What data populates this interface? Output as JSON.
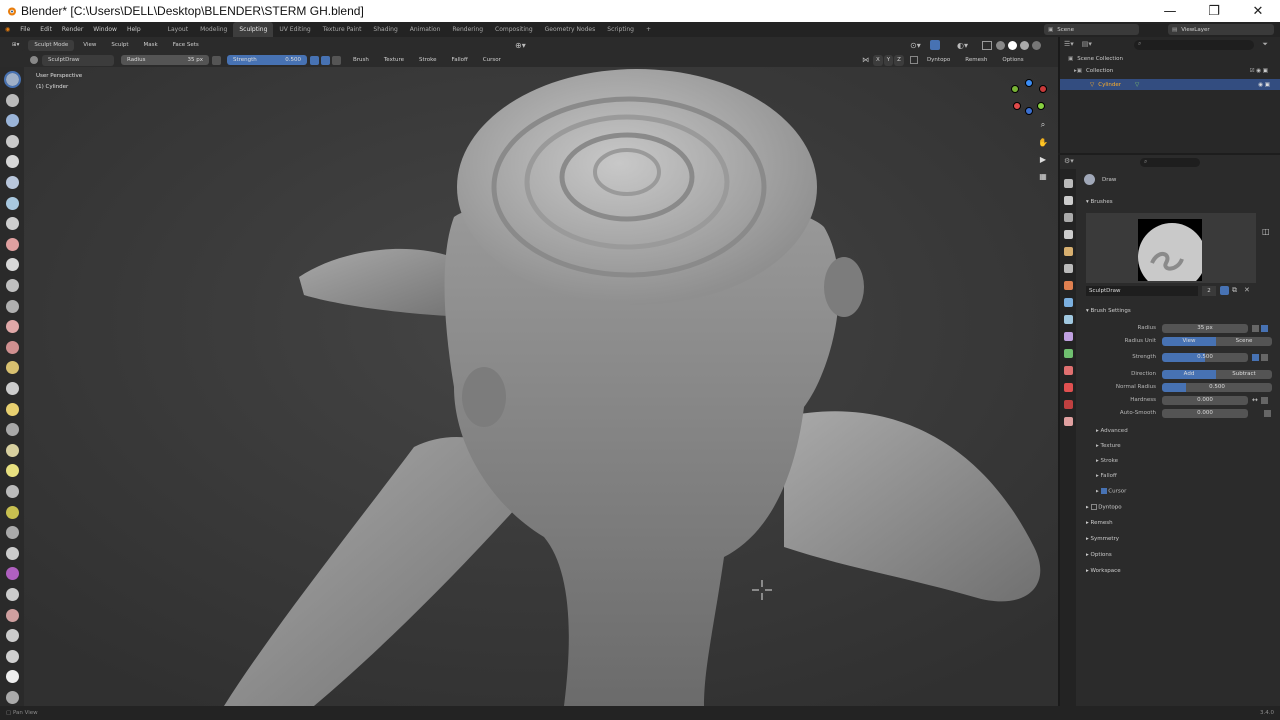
{
  "window": {
    "title": "Blender* [C:\\Users\\DELL\\Desktop\\BLENDER\\STERM GH.blend]",
    "minimize": "—",
    "maximize": "❐",
    "close": "✕"
  },
  "menu": {
    "items": [
      "File",
      "Edit",
      "Render",
      "Window",
      "Help"
    ],
    "workspaces": [
      "Layout",
      "Modeling",
      "Sculpting",
      "UV Editing",
      "Texture Paint",
      "Shading",
      "Animation",
      "Rendering",
      "Compositing",
      "Geometry Nodes",
      "Scripting"
    ],
    "active_workspace": "Sculpting",
    "add_tab": "+",
    "scene": "Scene",
    "view_layer": "ViewLayer"
  },
  "header": {
    "mode": "Sculpt Mode",
    "menus": [
      "View",
      "Sculpt",
      "Mask",
      "Face Sets"
    ]
  },
  "tool_header": {
    "brush_name": "SculptDraw",
    "radius_label": "Radius",
    "radius_value": "35 px",
    "strength_label": "Strength",
    "strength_value": "0.500",
    "menus": [
      "Brush",
      "Texture",
      "Stroke",
      "Falloff",
      "Cursor"
    ],
    "axes": [
      "X",
      "Y",
      "Z"
    ],
    "dyntopo": "Dyntopo",
    "remesh": "Remesh",
    "options": "Options"
  },
  "viewport": {
    "perspective": "User Perspective",
    "object": "(1) Cylinder"
  },
  "outliner": {
    "items": [
      "Scene Collection",
      "Collection",
      "Cylinder"
    ]
  },
  "properties": {
    "brush_title": "Draw",
    "brushes_section": "Brushes",
    "brush_field": "SculptDraw",
    "brush_users": "2",
    "brush_settings": "Brush Settings",
    "radius_label": "Radius",
    "radius_value": "35 px",
    "radius_unit_label": "Radius Unit",
    "radius_unit_view": "View",
    "radius_unit_scene": "Scene",
    "strength_label": "Strength",
    "strength_value": "0.500",
    "direction_label": "Direction",
    "direction_add": "Add",
    "direction_subtract": "Subtract",
    "normal_radius_label": "Normal Radius",
    "normal_radius_value": "0.500",
    "hardness_label": "Hardness",
    "hardness_value": "0.000",
    "auto_smooth_label": "Auto-Smooth",
    "auto_smooth_value": "0.000",
    "subpanels": [
      "Advanced",
      "Texture",
      "Stroke",
      "Falloff",
      "Cursor"
    ],
    "panels": [
      "Dyntopo",
      "Remesh",
      "Symmetry",
      "Options",
      "Workspace"
    ]
  },
  "status": {
    "left": "Pan View",
    "right": "3.4.0"
  },
  "colors": {
    "accent": "#4772b3",
    "viewport_bg": "#3b3b3b",
    "panel_bg": "#2b2b2b"
  }
}
